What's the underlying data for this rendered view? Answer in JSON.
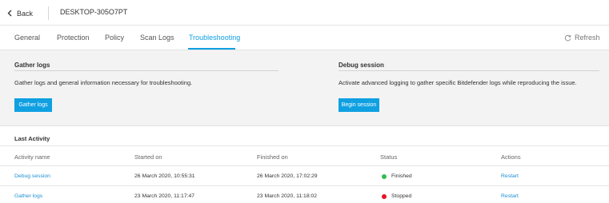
{
  "header": {
    "back_label": "Back",
    "device_name": "DESKTOP-305O7PT"
  },
  "tabs": [
    {
      "label": "General",
      "active": false
    },
    {
      "label": "Protection",
      "active": false
    },
    {
      "label": "Policy",
      "active": false
    },
    {
      "label": "Scan Logs",
      "active": false
    },
    {
      "label": "Troubleshooting",
      "active": true
    }
  ],
  "refresh_label": "Refresh",
  "gather": {
    "title": "Gather logs",
    "description": "Gather logs and general information necessary for troubleshooting.",
    "button": "Gather logs"
  },
  "debug": {
    "title": "Debug session",
    "description": "Activate advanced logging to gather specific Bitdefender logs while reproducing the issue.",
    "button": "Begin session"
  },
  "activity": {
    "title": "Last Activity",
    "columns": [
      "Activity name",
      "Started on",
      "Finished on",
      "Status",
      "Actions"
    ],
    "rows": [
      {
        "name": "Debug session",
        "started": "26 March 2020, 10:55:31",
        "finished": "26 March 2020, 17:02:29",
        "status": "Finished",
        "status_color": "#2dbe4f",
        "action": "Restart"
      },
      {
        "name": "Gather logs",
        "started": "23 March 2020, 11:17:47",
        "finished": "23 March 2020, 11:18:02",
        "status": "Stopped",
        "status_color": "#e81123",
        "action": "Restart"
      }
    ]
  },
  "colors": {
    "accent": "#0fa0e1",
    "link": "#1b8fd1",
    "panel_bg": "#f3f3f3"
  }
}
